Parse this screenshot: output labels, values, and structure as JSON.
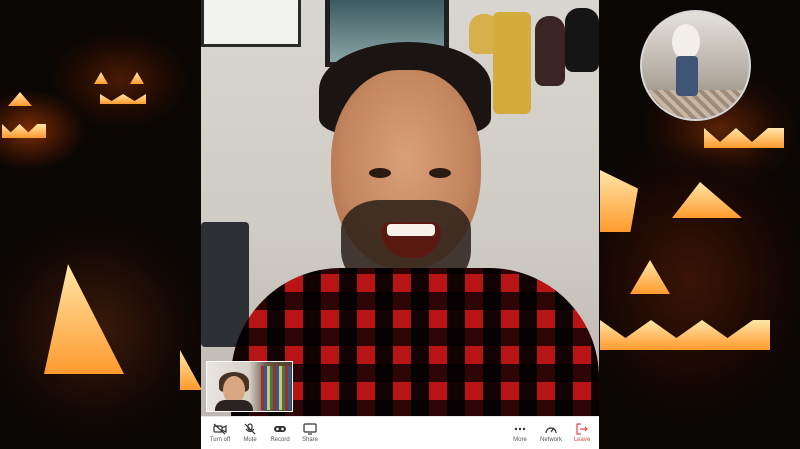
{
  "toolbar": {
    "left": [
      {
        "label": "Turn off",
        "icon": "video-off-icon"
      },
      {
        "label": "Mute",
        "icon": "mic-off-icon"
      },
      {
        "label": "Record",
        "icon": "record-icon"
      },
      {
        "label": "Share",
        "icon": "screen-share-icon"
      }
    ],
    "right": [
      {
        "label": "More",
        "icon": "more-dots-icon"
      },
      {
        "label": "Network",
        "icon": "network-gauge-icon"
      },
      {
        "label": "Leave",
        "icon": "leave-icon"
      }
    ],
    "leave_color": "#e44444"
  }
}
